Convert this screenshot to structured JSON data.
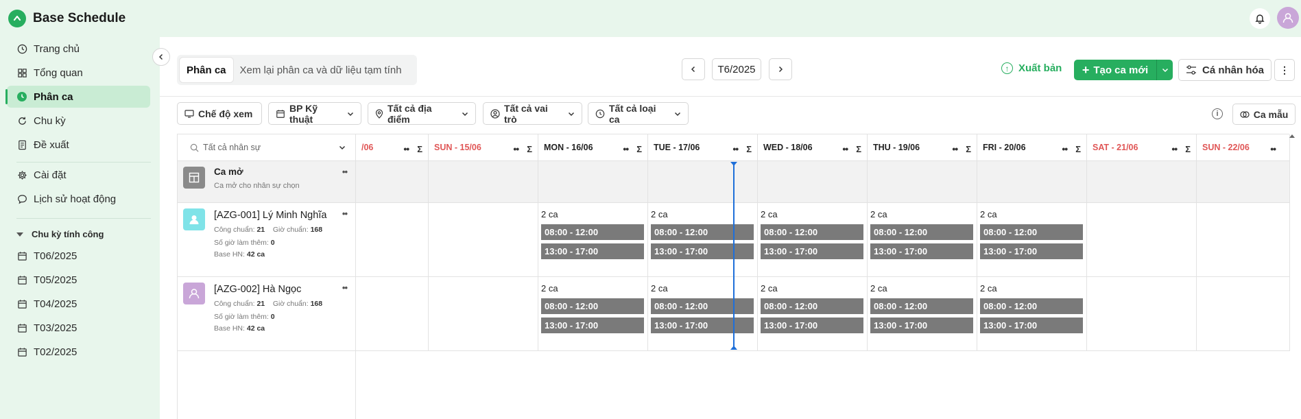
{
  "app": {
    "name": "Base Schedule",
    "accent": "#27ae5f",
    "sidebar_bg": "#e8f6ec"
  },
  "sidebar": {
    "items": [
      {
        "label": "Trang chủ",
        "icon": "clock-icon"
      },
      {
        "label": "Tổng quan",
        "icon": "grid-icon"
      },
      {
        "label": "Phân ca",
        "icon": "shift-clock-icon",
        "active": true
      },
      {
        "label": "Chu kỳ",
        "icon": "refresh-icon"
      },
      {
        "label": "Đề xuất",
        "icon": "document-icon"
      },
      {
        "label": "Cài đặt",
        "icon": "gear-icon"
      },
      {
        "label": "Lịch sử hoạt động",
        "icon": "chat-icon"
      }
    ],
    "period_header": "Chu kỳ tính công",
    "periods": [
      "T06/2025",
      "T05/2025",
      "T04/2025",
      "T03/2025",
      "T02/2025"
    ]
  },
  "toolbar": {
    "tabs": [
      "Phân ca",
      "Xem lại phân ca và dữ liệu tạm tính"
    ],
    "month": "T6/2025",
    "publish_label": "Xuất bản",
    "create_label": "Tạo ca mới",
    "customize_label": "Cá nhân hóa",
    "more_label": "⋮"
  },
  "filters": {
    "view_mode": "Chế độ xem",
    "department": "BP Kỹ thuật",
    "location": "Tất cả địa điểm",
    "role": "Tất cả vai trò",
    "shift_type": "Tất cả loại ca",
    "template": "Ca mẫu"
  },
  "grid": {
    "search_placeholder": "Tất cả nhân sự",
    "sigma": "Σ",
    "days": [
      {
        "label": "/06",
        "weekend": true
      },
      {
        "label": "SUN - 15/06",
        "weekend": true
      },
      {
        "label": "MON - 16/06",
        "weekend": false
      },
      {
        "label": "TUE - 17/06",
        "weekend": false
      },
      {
        "label": "WED - 18/06",
        "weekend": false
      },
      {
        "label": "THU - 19/06",
        "weekend": false
      },
      {
        "label": "FRI - 20/06",
        "weekend": false
      },
      {
        "label": "SAT - 21/06",
        "weekend": true
      },
      {
        "label": "SUN - 22/06",
        "weekend": true
      }
    ],
    "open_shift": {
      "title": "Ca mở",
      "subtitle": "Ca mở cho nhân sự chọn"
    },
    "meta_labels": {
      "standard_days": "Công chuẩn:",
      "standard_hours": "Giờ chuẩn:",
      "overtime": "Số giờ làm thêm:",
      "base": "Base HN:"
    },
    "employees": [
      {
        "name": "[AZG-001] Lý Minh Nghĩa",
        "standard_days": "21",
        "standard_hours": "168",
        "overtime": "0",
        "base": "42 ca",
        "avatar_color": "#7fe3e8",
        "count": "2 ca",
        "shifts": [
          "08:00 - 12:00",
          "13:00 - 17:00"
        ]
      },
      {
        "name": "[AZG-002] Hà Ngọc",
        "standard_days": "21",
        "standard_hours": "168",
        "overtime": "0",
        "base": "42 ca",
        "avatar_color": "#c9a6d8",
        "count": "2 ca",
        "shifts": [
          "08:00 - 12:00",
          "13:00 - 17:00"
        ]
      }
    ]
  }
}
